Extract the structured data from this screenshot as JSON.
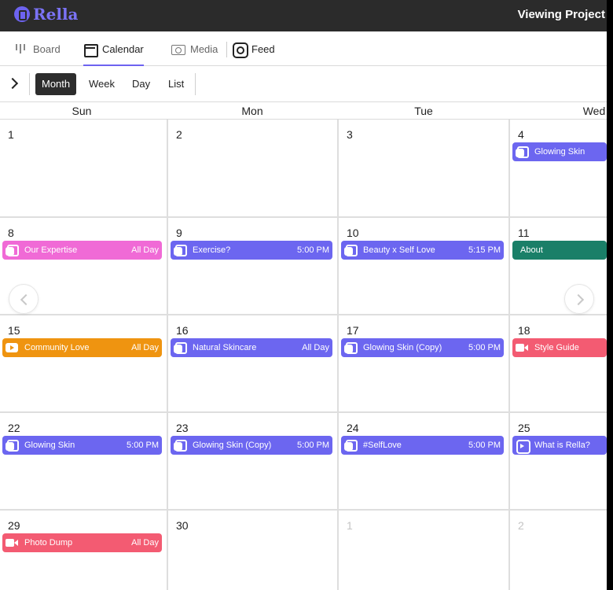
{
  "app": {
    "logo_text": "Rella",
    "header_right": "Viewing Project"
  },
  "tabs": [
    {
      "label": "Board",
      "icon": "board-icon",
      "active": false
    },
    {
      "label": "Calendar",
      "icon": "calendar-icon",
      "active": true
    },
    {
      "label": "Media",
      "icon": "camera-icon",
      "active": false
    },
    {
      "label": "Feed",
      "icon": "instagram-icon",
      "active": false
    }
  ],
  "toolbar": {
    "views": [
      "Month",
      "Week",
      "Day",
      "List"
    ],
    "active_view": "Month"
  },
  "calendar": {
    "day_names": [
      "Sun",
      "Mon",
      "Tue",
      "Wed"
    ],
    "weeks": [
      [
        {
          "date": "1",
          "muted": false,
          "events": []
        },
        {
          "date": "2",
          "muted": false,
          "events": []
        },
        {
          "date": "3",
          "muted": false,
          "events": []
        },
        {
          "date": "4",
          "muted": false,
          "events": [
            {
              "title": "Glowing Skin",
              "time": "",
              "color": "#6c66f0",
              "icon": "carousel-icon"
            }
          ]
        }
      ],
      [
        {
          "date": "8",
          "muted": false,
          "events": [
            {
              "title": "Our Expertise",
              "time": "All Day",
              "color": "#f06ad6",
              "icon": "carousel-icon"
            }
          ]
        },
        {
          "date": "9",
          "muted": false,
          "events": [
            {
              "title": "Exercise?",
              "time": "5:00 PM",
              "color": "#6c66f0",
              "icon": "carousel-icon"
            }
          ]
        },
        {
          "date": "10",
          "muted": false,
          "events": [
            {
              "title": "Beauty x Self Love",
              "time": "5:15 PM",
              "color": "#6c66f0",
              "icon": "carousel-icon"
            }
          ]
        },
        {
          "date": "11",
          "muted": false,
          "events": [
            {
              "title": "About",
              "time": "",
              "color": "#1a7f68",
              "icon": ""
            }
          ]
        }
      ],
      [
        {
          "date": "15",
          "muted": false,
          "events": [
            {
              "title": "Community Love",
              "time": "All Day",
              "color": "#ef9410",
              "icon": "youtube-icon"
            }
          ]
        },
        {
          "date": "16",
          "muted": false,
          "events": [
            {
              "title": "Natural Skincare",
              "time": "All Day",
              "color": "#6c66f0",
              "icon": "carousel-icon"
            }
          ]
        },
        {
          "date": "17",
          "muted": false,
          "events": [
            {
              "title": "Glowing Skin (Copy)",
              "time": "5:00 PM",
              "color": "#6c66f0",
              "icon": "carousel-icon"
            }
          ]
        },
        {
          "date": "18",
          "muted": false,
          "events": [
            {
              "title": "Style Guide",
              "time": "",
              "color": "#f35b72",
              "icon": "video-icon"
            }
          ]
        }
      ],
      [
        {
          "date": "22",
          "muted": false,
          "events": [
            {
              "title": "Glowing Skin",
              "time": "5:00 PM",
              "color": "#6c66f0",
              "icon": "carousel-icon"
            }
          ]
        },
        {
          "date": "23",
          "muted": false,
          "events": [
            {
              "title": "Glowing Skin (Copy)",
              "time": "5:00 PM",
              "color": "#6c66f0",
              "icon": "carousel-icon"
            }
          ]
        },
        {
          "date": "24",
          "muted": false,
          "events": [
            {
              "title": "#SelfLove",
              "time": "5:00 PM",
              "color": "#6c66f0",
              "icon": "carousel-icon"
            }
          ]
        },
        {
          "date": "25",
          "muted": false,
          "events": [
            {
              "title": "What is Rella?",
              "time": "",
              "color": "#6c66f0",
              "icon": "reel-icon"
            }
          ]
        }
      ],
      [
        {
          "date": "29",
          "muted": false,
          "events": [
            {
              "title": "Photo Dump",
              "time": "All Day",
              "color": "#f35b72",
              "icon": "video-icon"
            }
          ]
        },
        {
          "date": "30",
          "muted": false,
          "events": []
        },
        {
          "date": "1",
          "muted": true,
          "events": []
        },
        {
          "date": "2",
          "muted": true,
          "events": []
        }
      ]
    ]
  }
}
